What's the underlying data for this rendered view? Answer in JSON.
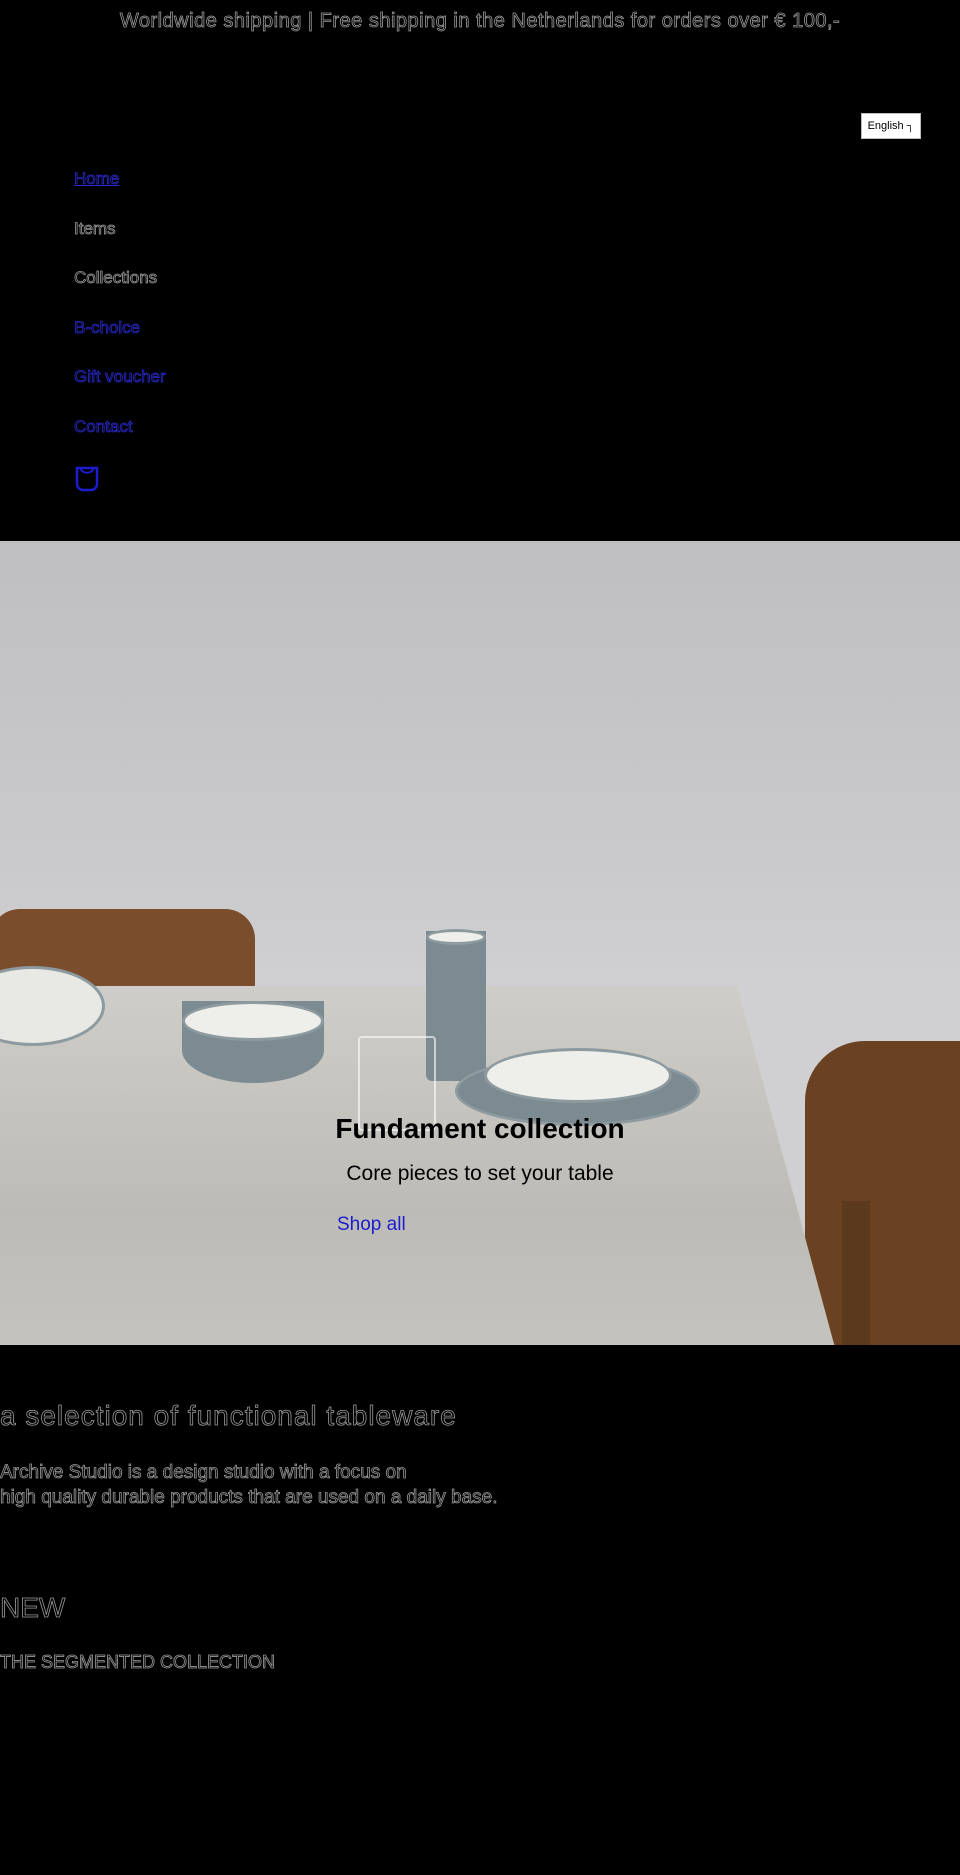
{
  "announcement": "Worldwide shipping | Free shipping in the Netherlands for orders over € 100,-",
  "language_selector": {
    "selected": "English",
    "icon": "chevron-down-icon"
  },
  "nav": {
    "items": [
      {
        "label": "Home"
      },
      {
        "label": "Items"
      },
      {
        "label": "Collections"
      },
      {
        "label": "B-choice"
      },
      {
        "label": "Gift voucher"
      },
      {
        "label": "Contact"
      }
    ],
    "cart_icon": "shopping-bag-icon"
  },
  "hero": {
    "title": "Fundament collection",
    "subtitle": "Core pieces to set your table",
    "cta": "Shop all"
  },
  "about": {
    "heading": "a selection of functional tableware",
    "line1": "Archive Studio is a design studio with a focus on",
    "line2": "high quality durable products that are used on a daily base."
  },
  "featured": {
    "heading": "NEW",
    "subheading": "THE SEGMENTED COLLECTION"
  },
  "colors": {
    "background": "#000000",
    "link": "#1c1cd0",
    "text_outline": "#9a9a9a"
  }
}
